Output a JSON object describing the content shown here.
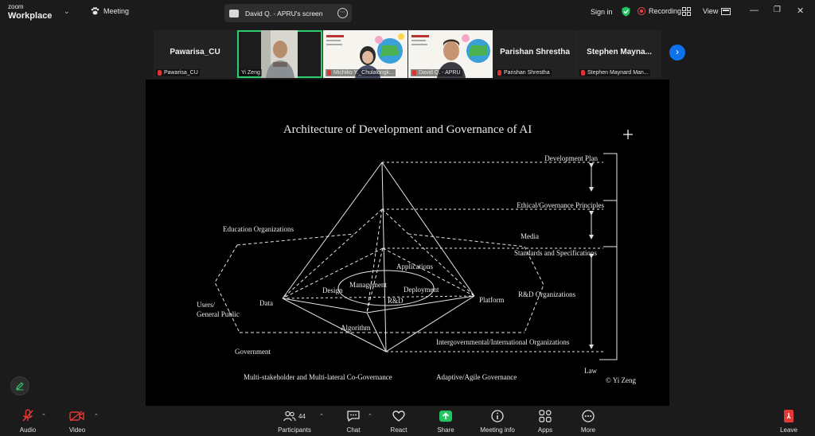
{
  "app": {
    "brand_top": "zoom",
    "brand_bottom": "Workplace",
    "meeting_label": "Meeting",
    "screen_tab_label": "David Q. - APRU's screen",
    "sign_in": "Sign in",
    "recording": "Recording",
    "view": "View"
  },
  "participants": [
    {
      "display": "Pawarisa_CU",
      "name": "Pawarisa_CU"
    },
    {
      "display": "",
      "name": "Yi Zeng"
    },
    {
      "display": "",
      "name": "Michiko Y._Chulalongk..."
    },
    {
      "display": "",
      "name": "David Q. - APRU"
    },
    {
      "display": "Parishan Shrestha",
      "name": "Parishan Shrestha"
    },
    {
      "display": "Stephen Mayna...",
      "name": "Stephen Maynard Man..."
    }
  ],
  "slide": {
    "title": "Architecture of Development and Governance of AI",
    "labels": {
      "development_plan": "Development Plan",
      "ethical": "Ethical/Governance Principles",
      "education": "Education Organizations",
      "media": "Media",
      "standards": "Standards and Specifications",
      "applications": "Applications",
      "management": "Management",
      "design": "Design",
      "deployment": "Deployment",
      "rd": "R&D",
      "data": "Data",
      "platform": "Platform",
      "rd_orgs": "R&D Organizations",
      "users_1": "Users/",
      "users_2": "General Public",
      "algorithm": "Algorithm",
      "government": "Government",
      "intergov": "Intergovernmental/International Organizations",
      "law": "Law",
      "multi": "Multi-stakeholder and Multi-lateral Co-Governance",
      "adaptive": "Adaptive/Agile Governance",
      "credit": "© Yi Zeng"
    }
  },
  "toolbar": {
    "audio": "Audio",
    "video": "Video",
    "participants": "Participants",
    "participants_count": "44",
    "chat": "Chat",
    "react": "React",
    "share": "Share",
    "meeting_info": "Meeting info",
    "apps": "Apps",
    "more": "More",
    "leave": "Leave"
  },
  "colors": {
    "active_speaker": "#2ecc71",
    "share_green": "#22c55e",
    "accent_blue": "#0e72ed",
    "muted_red": "#e53935",
    "shield_green": "#22c55e"
  }
}
